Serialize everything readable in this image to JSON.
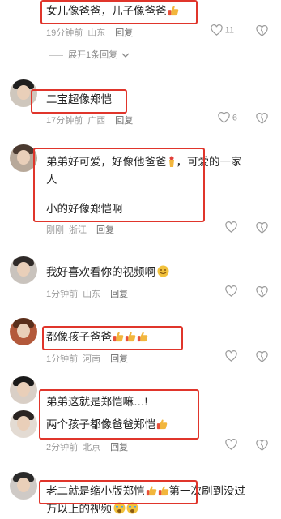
{
  "comments": [
    {
      "lines": [
        "女儿像爸爸，儿子像爸爸"
      ],
      "thumbs": 1,
      "time": "19分钟前",
      "location": "山东",
      "reply": "回复",
      "likes": "11",
      "expand_label": "展开1条回复"
    },
    {
      "lines": [
        "二宝超像郑恺"
      ],
      "time": "17分钟前",
      "location": "广西",
      "reply": "回复",
      "likes": "6"
    },
    {
      "line1": "弟弟好可爱，好像他爸爸",
      "line1b": "，可爱的一家",
      "line2": "人",
      "line3": "小的好像郑恺啊",
      "time": "刚刚",
      "location": "浙江",
      "reply": "回复"
    },
    {
      "lines": [
        "我好喜欢看你的视频啊"
      ],
      "time": "1分钟前",
      "location": "山东",
      "reply": "回复"
    },
    {
      "lines": [
        "都像孩子爸爸"
      ],
      "thumbs": 3,
      "time": "1分钟前",
      "location": "河南",
      "reply": "回复"
    },
    {
      "line1": "弟弟这就是郑恺嘛…!",
      "line2": "两个孩子都像爸爸郑恺",
      "thumbs": 1,
      "time": "2分钟前",
      "location": "北京",
      "reply": "回复"
    },
    {
      "line1": "老二就是缩小版郑恺",
      "line1b": "第一次刷到没过",
      "line2": "万以上的视频",
      "thumbs": 2
    }
  ],
  "colors": {
    "highlight_box": "#e0352b",
    "meta": "#9a9a9a",
    "thumb": "#f2b63d",
    "cuff": "#e7503a"
  },
  "icons": [
    "heart-icon",
    "dislike-icon",
    "thumbs-up-emoji",
    "chevron-down-icon",
    "pinched-fingers-emoji",
    "smile-emoji",
    "crying-face-emoji"
  ]
}
